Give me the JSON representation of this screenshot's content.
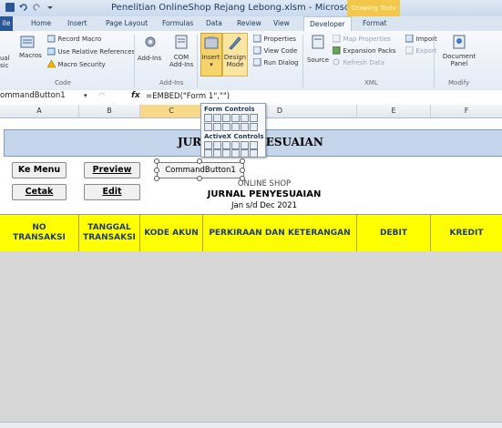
{
  "window": {
    "title": "Penelitian OnlineShop Rejang Lebong.xlsm  -  Microsoft Excel",
    "contextual_group": "Drawing Tools"
  },
  "tabs": [
    "Home",
    "Insert",
    "Page Layout",
    "Formulas",
    "Data",
    "Review",
    "View",
    "Developer",
    "Format"
  ],
  "file_tab": "ile",
  "active_tab": "Developer",
  "ribbon": {
    "code": {
      "visual_basic": "ual\nsic",
      "macros": "Macros",
      "record_macro": "Record Macro",
      "use_relative": "Use Relative References",
      "macro_security": "Macro Security",
      "label": "Code"
    },
    "addins": {
      "addins": "Add-Ins",
      "com_addins": "COM\nAdd-Ins",
      "label": "Add-Ins"
    },
    "controls": {
      "insert": "Insert",
      "design_mode": "Design\nMode",
      "properties": "Properties",
      "view_code": "View Code",
      "run_dialog": "Run Dialog"
    },
    "xml": {
      "source": "Source",
      "map_properties": "Map Properties",
      "import": "Import",
      "expansion_packs": "Expansion Packs",
      "export": "Export",
      "refresh_data": "Refresh Data",
      "label": "XML"
    },
    "modify": {
      "document_panel": "Document\nPanel",
      "label": "Modify"
    }
  },
  "dropdown": {
    "form_controls": "Form Controls",
    "activex_controls": "ActiveX Controls"
  },
  "formula_bar": {
    "name_box": "ommandButton1",
    "fx": "fx",
    "formula": "=EMBED(\"Form                          1\",\"\")"
  },
  "columns": [
    "A",
    "B",
    "C",
    "D",
    "E",
    "F"
  ],
  "sheet": {
    "banner_title": "JURNAL PENYESUAIAN",
    "buttons": {
      "ke_menu": "Ke Menu",
      "preview": "Preview",
      "cetak": "Cetak",
      "edit": "Edit"
    },
    "command_button": "CommandButton1",
    "header": {
      "shop": "ONLINE SHOP",
      "title": "JURNAL PENYESUAIAN",
      "period": "Jan s/d Dec 2021"
    },
    "table_headers": [
      "NO\nTRANSAKSI",
      "TANGGAL\nTRANSAKSI",
      "KODE AKUN",
      "PERKIRAAN DAN KETERANGAN",
      "DEBIT",
      "KREDIT"
    ]
  },
  "colors": {
    "header_fill": "#ffff00",
    "header_text": "#1f3b6b",
    "banner_fill": "#c5d5ea",
    "empty_area": "#d7d7d7",
    "contextual_tab": "#f2c84b"
  }
}
